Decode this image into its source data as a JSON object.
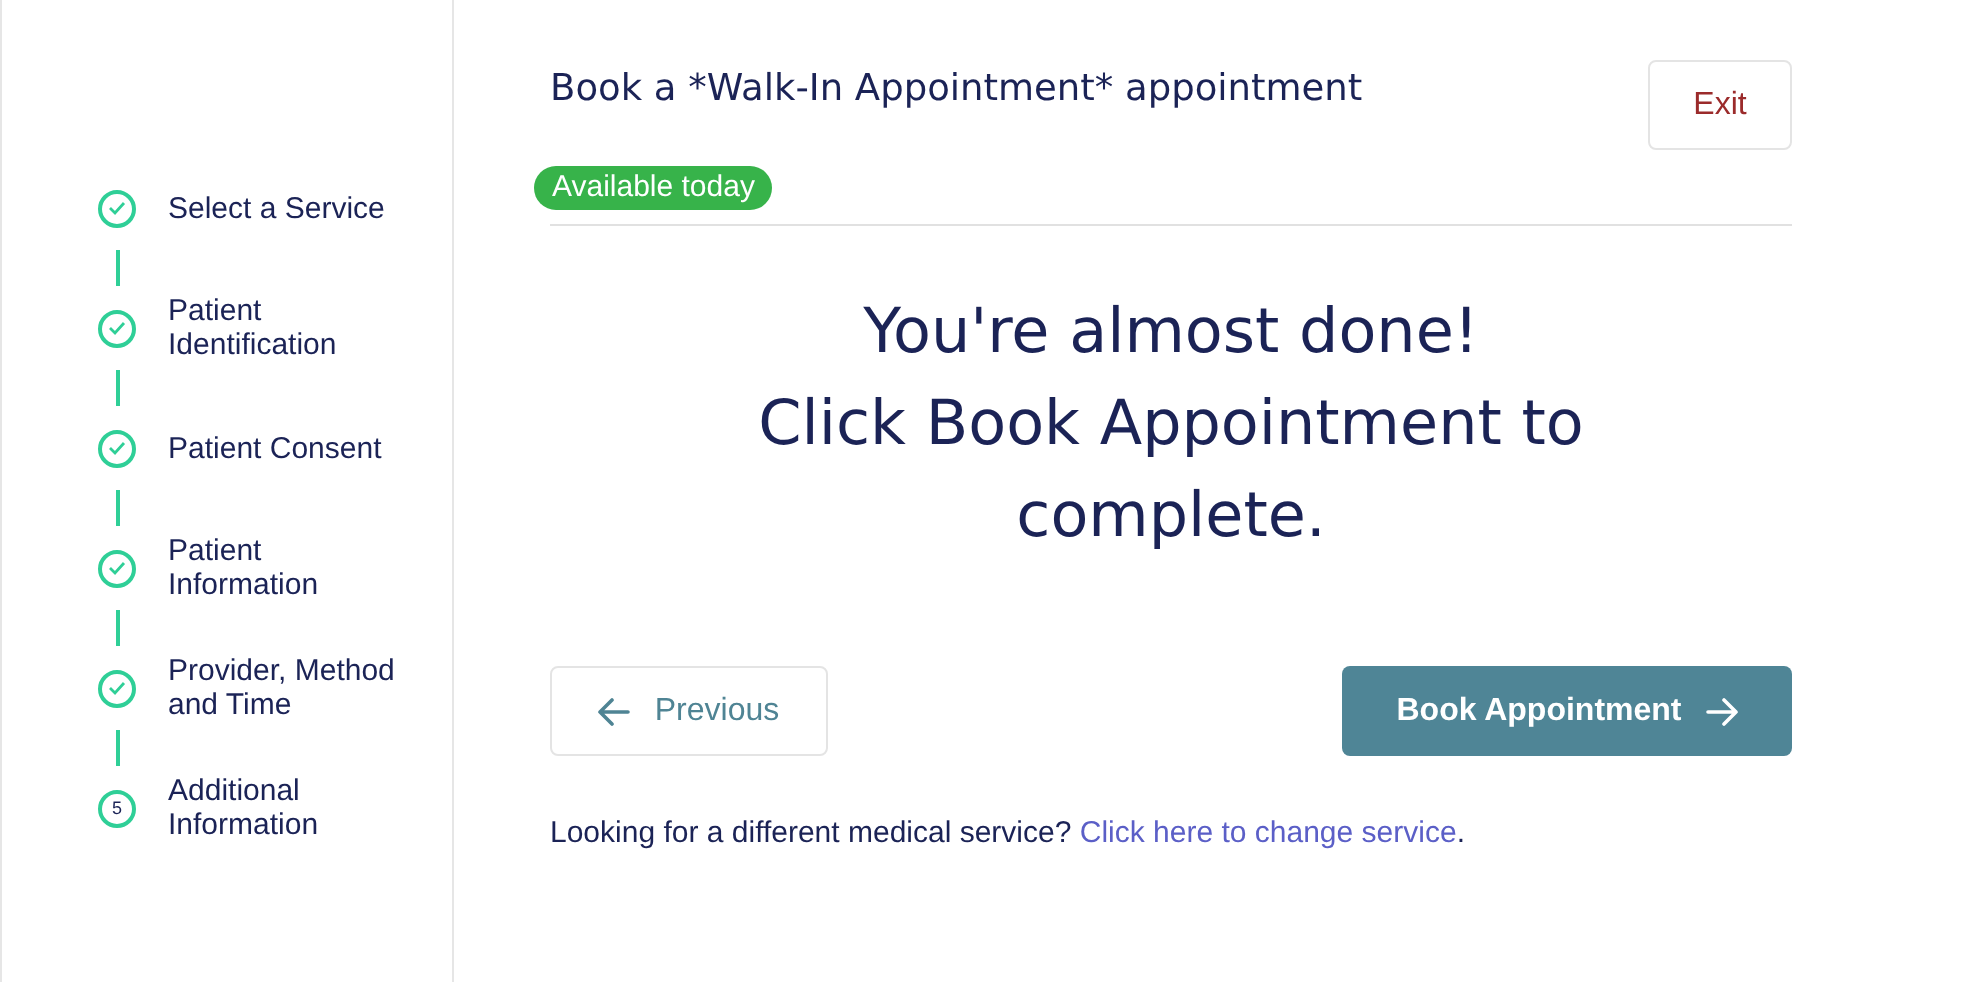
{
  "steps": [
    {
      "label": "Select a Service",
      "done": true
    },
    {
      "label": "Patient Identification",
      "done": true
    },
    {
      "label": "Patient Consent",
      "done": true
    },
    {
      "label": "Patient Information",
      "done": true
    },
    {
      "label": "Provider, Method and Time",
      "done": true
    },
    {
      "label": "Additional Information",
      "done": false,
      "number": "5"
    }
  ],
  "title": "Book a *Walk-In Appointment* appointment",
  "exit_button": "Exit",
  "badge": "Available today",
  "message_lines": [
    "You're almost done!",
    "Click Book Appointment to complete."
  ],
  "previous_button": "Previous",
  "book_button": "Book Appointment",
  "footer": {
    "text": "Looking for a different medical service? ",
    "link": "Click here to change service",
    "after": "."
  }
}
